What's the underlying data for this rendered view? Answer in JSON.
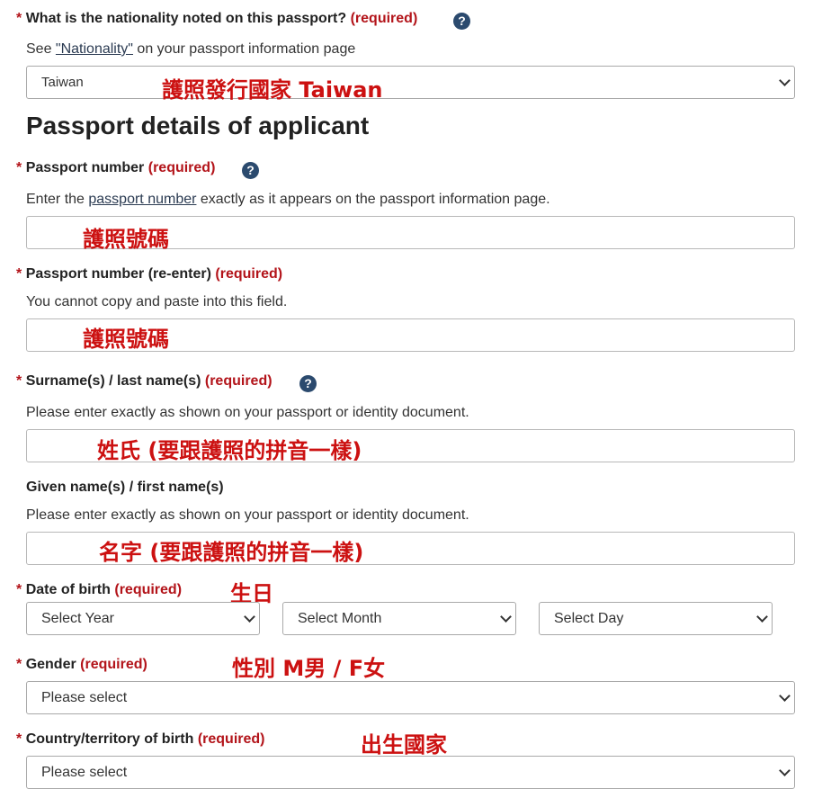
{
  "nationality": {
    "label": "What is the nationality noted on this passport?",
    "required": "(required)",
    "help_prefix": "See ",
    "help_link": "\"Nationality\"",
    "help_suffix": " on your passport information page",
    "selected": "Taiwan",
    "annotation": "護照發行國家  Taiwan"
  },
  "section_title": "Passport details of applicant",
  "passport_number": {
    "label": "Passport number",
    "required": "(required)",
    "help_prefix": "Enter the ",
    "help_link": "passport number",
    "help_suffix": " exactly as it appears on the passport information page.",
    "annotation": "護照號碼"
  },
  "passport_number_reenter": {
    "label": "Passport number (re-enter)",
    "required": "(required)",
    "help": "You cannot copy and paste into this field.",
    "annotation": "護照號碼"
  },
  "surname": {
    "label": "Surname(s) / last name(s)",
    "required": "(required)",
    "help": "Please enter exactly as shown on your passport or identity document.",
    "annotation": "姓氏 (要跟護照的拼音一樣)"
  },
  "given_name": {
    "label": "Given name(s) / first name(s)",
    "help": "Please enter exactly as shown on your passport or identity document.",
    "annotation": "名字 (要跟護照的拼音一樣)"
  },
  "date_of_birth": {
    "label": "Date of birth",
    "required": "(required)",
    "annotation": "生日",
    "year": "Select Year",
    "month": "Select Month",
    "day": "Select Day"
  },
  "gender": {
    "label": "Gender",
    "required": "(required)",
    "annotation": "性別  M男 / F女",
    "selected": "Please select"
  },
  "country_of_birth": {
    "label": "Country/territory of birth",
    "required": "(required)",
    "annotation": "出生國家",
    "selected": "Please select"
  },
  "common": {
    "star": "*",
    "help_icon": "?"
  }
}
